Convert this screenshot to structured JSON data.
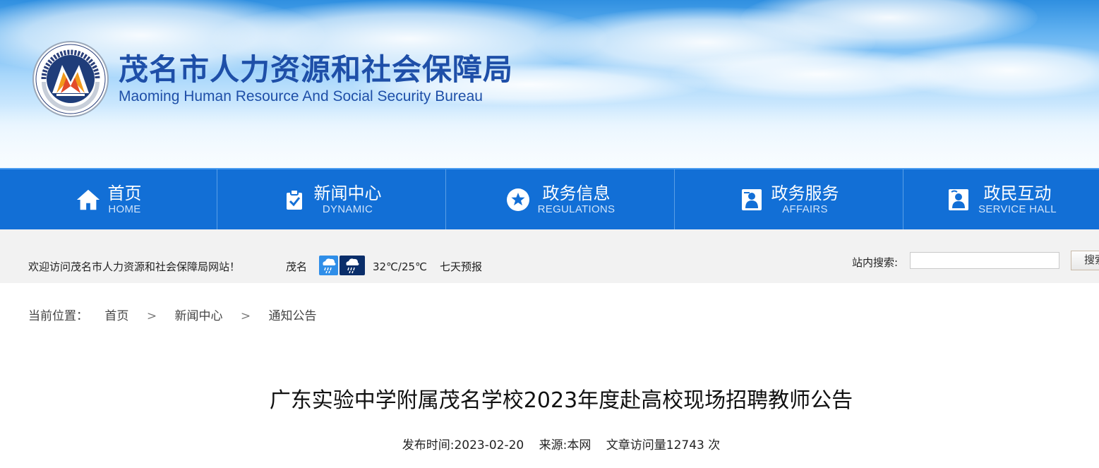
{
  "header": {
    "title_cn": "茂名市人力资源和社会保障局",
    "title_en": "Maoming Human Resource And Social Security Bureau"
  },
  "nav": [
    {
      "cn": "首页",
      "en": "HOME",
      "icon": "home-icon"
    },
    {
      "cn": "新闻中心",
      "en": "DYNAMIC",
      "icon": "clipboard-check-icon"
    },
    {
      "cn": "政务信息",
      "en": "REGULATIONS",
      "icon": "star-circle-icon"
    },
    {
      "cn": "政务服务",
      "en": "AFFAIRS",
      "icon": "service-person-icon"
    },
    {
      "cn": "政民互动",
      "en": "SERVICE HALL",
      "icon": "interaction-person-icon"
    }
  ],
  "infobar": {
    "welcome": "欢迎访问茂名市人力资源和社会保障局网站！",
    "city": "茂名",
    "weather_icons": [
      "rain-weather-icon",
      "night-rain-weather-icon"
    ],
    "temperature": "32℃/25℃",
    "forecast_link": "七天预报",
    "search_label": "站内搜索:",
    "search_value": "",
    "search_button": "搜索"
  },
  "breadcrumb": {
    "label": "当前位置：",
    "items": [
      "首页",
      "新闻中心",
      "通知公告"
    ],
    "separator": ">"
  },
  "article": {
    "title": "广东实验中学附属茂名学校2023年度赴高校现场招聘教师公告",
    "publish_time": "发布时间:2023-02-20",
    "source": "来源:本网",
    "views": "文章访问量12743 次"
  },
  "colors": {
    "nav_bg": "#126fd6",
    "title_blue": "#1e4fa8",
    "infobar_bg": "#f2f2f2"
  }
}
